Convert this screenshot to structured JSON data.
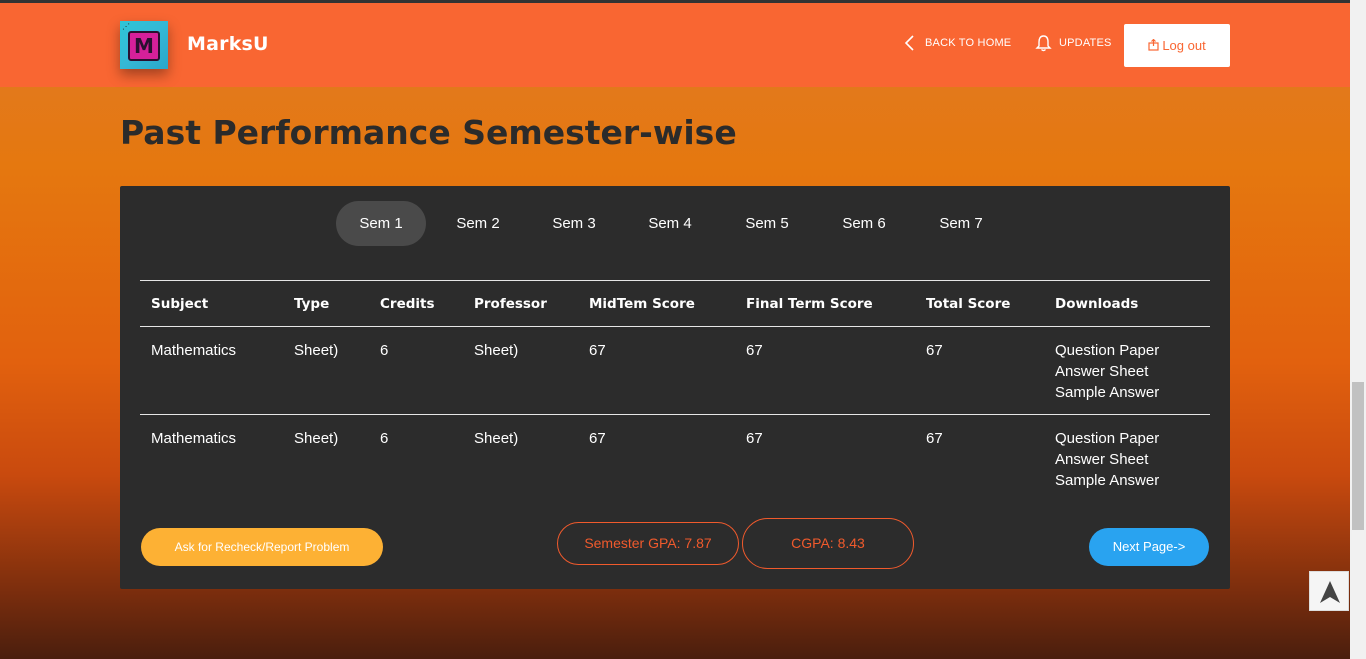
{
  "header": {
    "brand": "MarksU",
    "logo_letter": "M",
    "back_home": "BACK TO HOME",
    "updates": "UPDATES",
    "logout": "Log out"
  },
  "page": {
    "title": "Past Performance Semester-wise"
  },
  "tabs": [
    "Sem 1",
    "Sem 2",
    "Sem 3",
    "Sem 4",
    "Sem 5",
    "Sem 6",
    "Sem 7"
  ],
  "active_tab": "Sem 1",
  "table": {
    "headers": [
      "Subject",
      "Type",
      "Credits",
      "Professor",
      "MidTem Score",
      "Final Term Score",
      "Total Score",
      "Downloads"
    ],
    "rows": [
      {
        "subject": "Mathematics",
        "type": "Sheet)",
        "credits": "6",
        "professor": "Sheet)",
        "midterm": "67",
        "final": "67",
        "total": "67",
        "downloads": [
          "Question Paper",
          "Answer Sheet",
          "Sample Answer"
        ]
      },
      {
        "subject": "Mathematics",
        "type": "Sheet)",
        "credits": "6",
        "professor": "Sheet)",
        "midterm": "67",
        "final": "67",
        "total": "67",
        "downloads": [
          "Question Paper",
          "Answer Sheet",
          "Sample Answer"
        ]
      }
    ]
  },
  "footer": {
    "recheck": "Ask for Recheck/Report Problem",
    "semester_gpa": "Semester GPA: 7.87",
    "cgpa": "CGPA: 8.43",
    "next": "Next Page->"
  },
  "colors": {
    "navbar": "#f96632",
    "card": "#2c2c2c",
    "accent_orange": "#f05a2c",
    "recheck_yellow": "#fdb134",
    "next_blue": "#29a3f0"
  },
  "icons": {
    "back": "chevron-left-icon",
    "updates": "bell-icon",
    "logout": "logout-icon",
    "to_top": "arrow-up-icon"
  }
}
